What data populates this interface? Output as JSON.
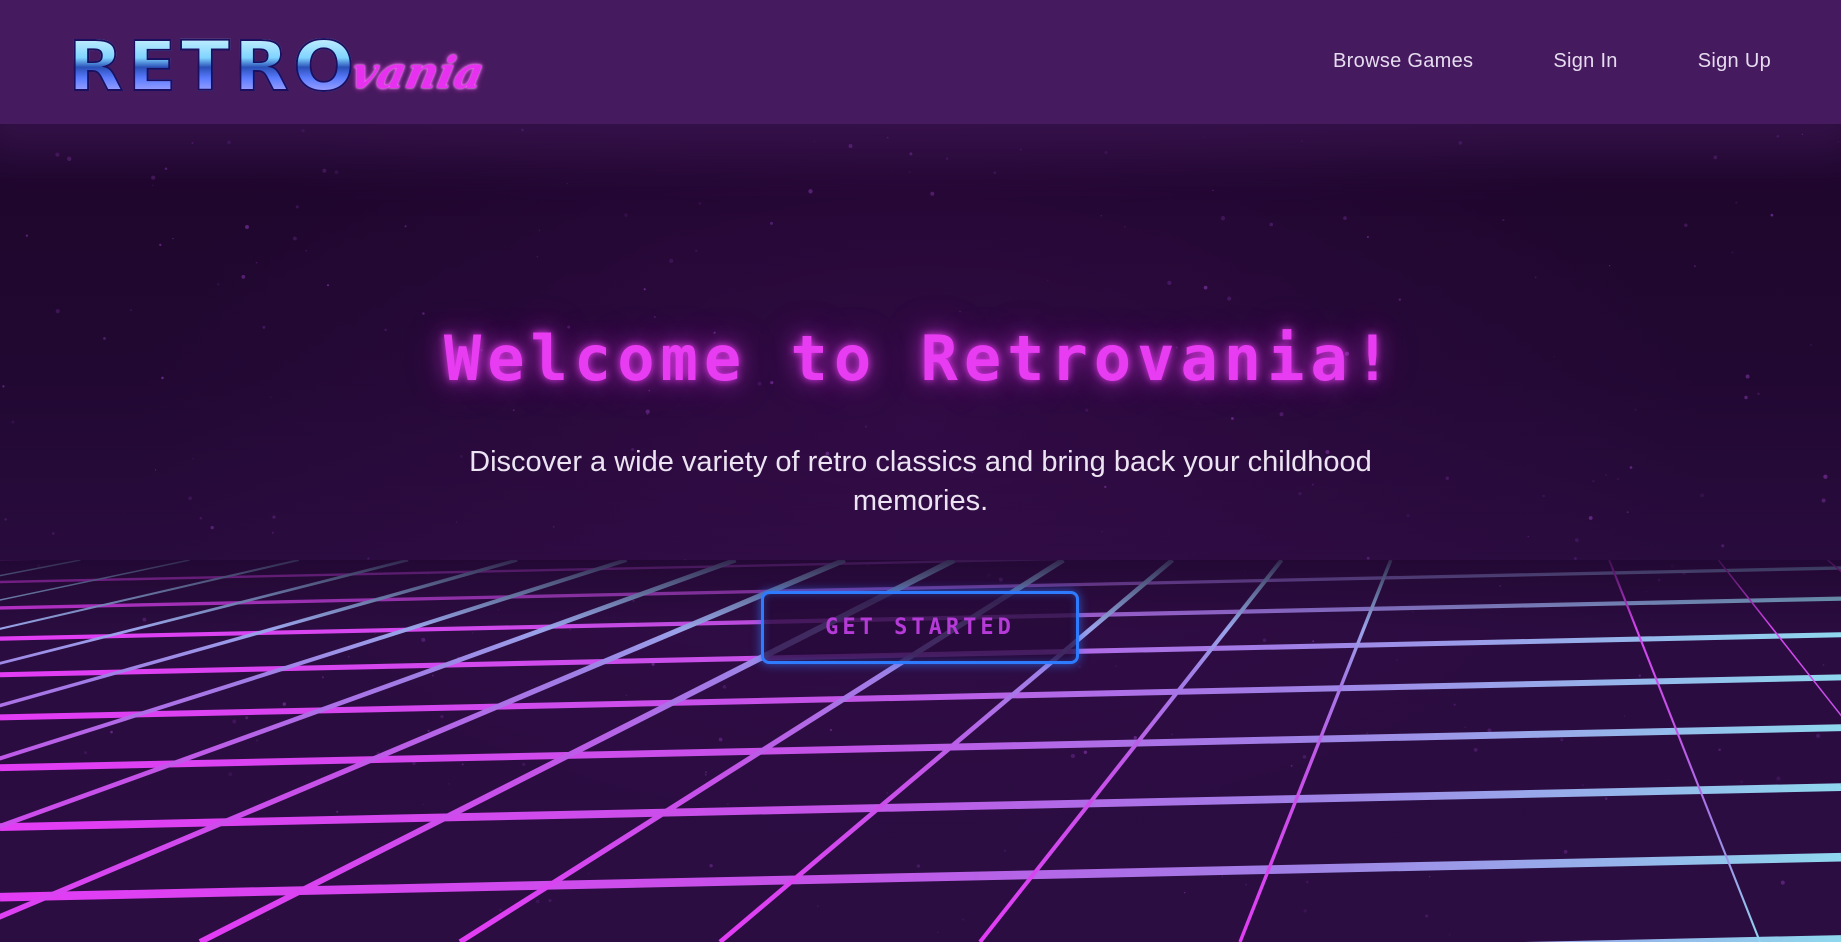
{
  "header": {
    "logo": {
      "main": "RETRO",
      "script": "vania"
    },
    "nav": [
      {
        "label": "Browse Games"
      },
      {
        "label": "Sign In"
      },
      {
        "label": "Sign Up"
      }
    ]
  },
  "hero": {
    "title": "Welcome to Retrovania!",
    "subtitle": "Discover a wide variety of retro classics and bring back your childhood memories.",
    "cta_label": "GET STARTED"
  },
  "colors": {
    "header_bg": "#461a5e",
    "page_bg": "#1c0528",
    "title_pink": "#e83cf2",
    "cta_border": "#2f7bff",
    "grid_pink": "#d93cf0",
    "grid_cyan": "#8fd6f0"
  }
}
